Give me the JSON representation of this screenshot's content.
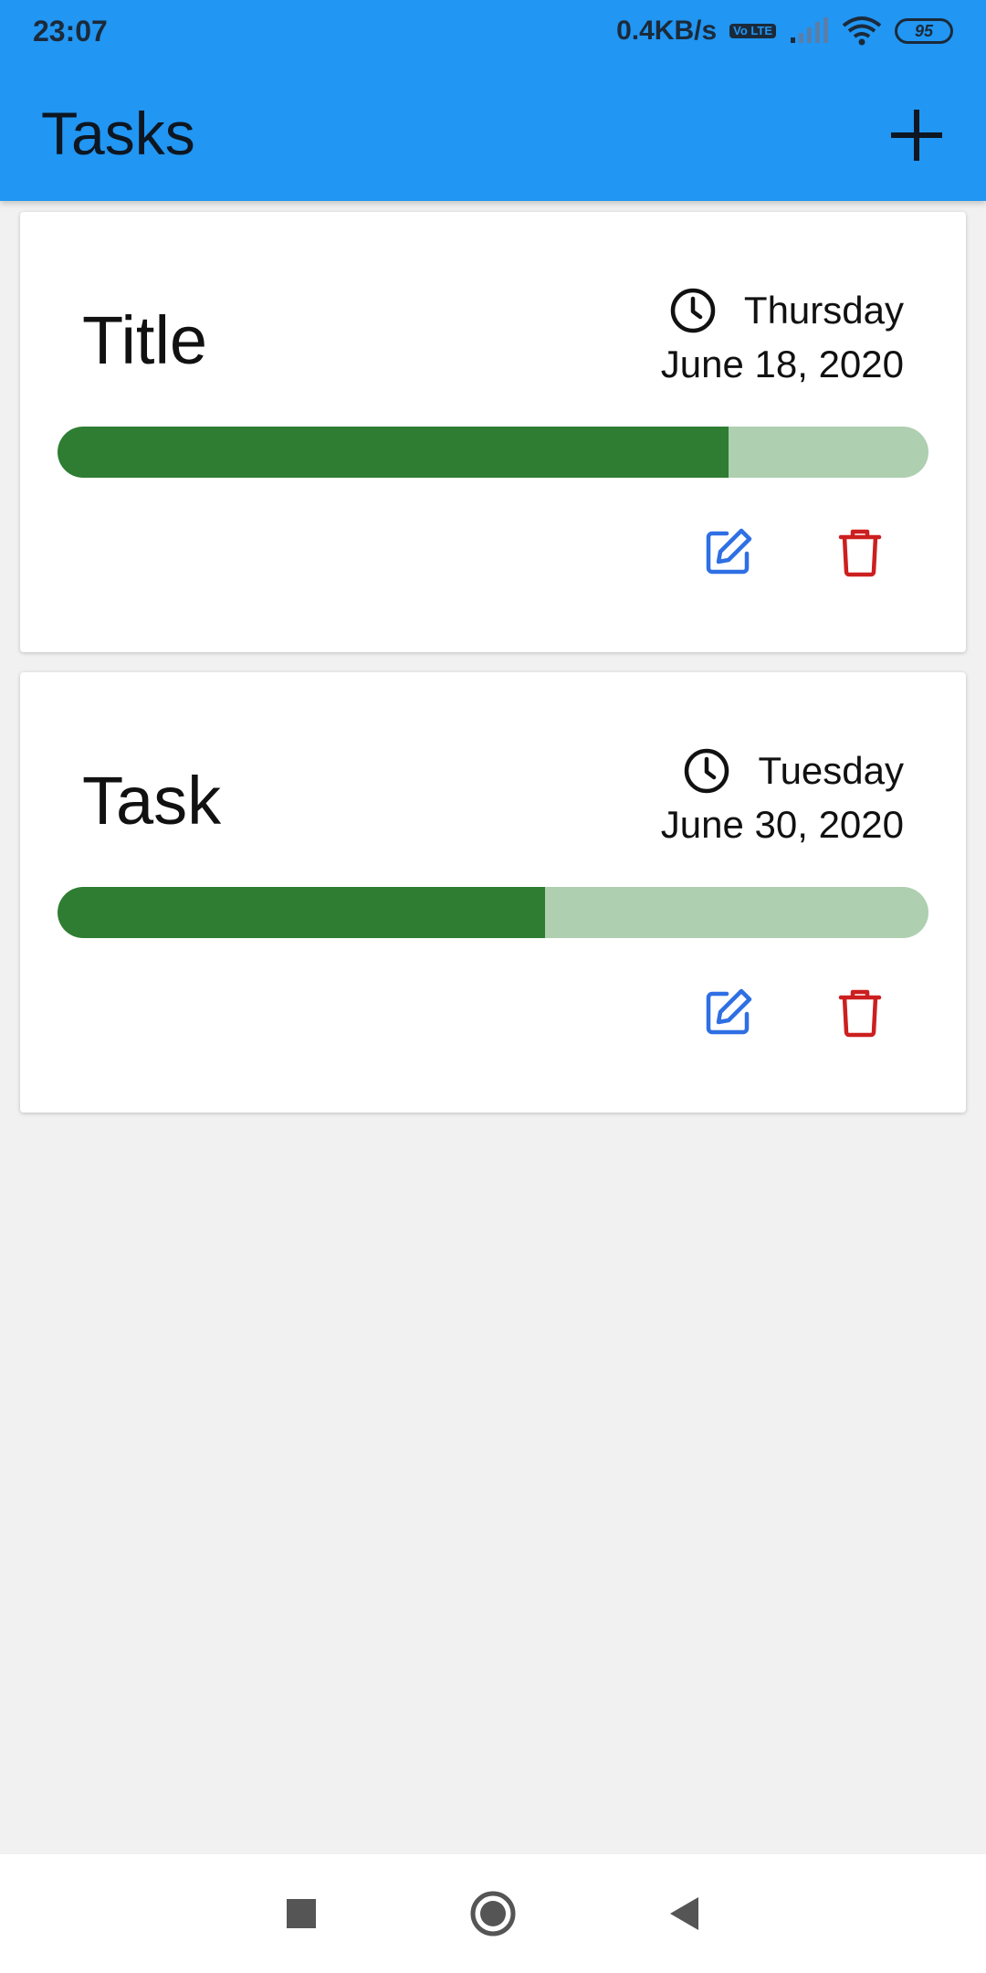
{
  "status_bar": {
    "time": "23:07",
    "net_speed": "0.4KB/s",
    "volte_label": "Vo LTE",
    "battery": "95"
  },
  "app_bar": {
    "title": "Tasks",
    "add_icon": "plus-icon"
  },
  "tasks": [
    {
      "title": "Title",
      "day": "Thursday",
      "date": "June 18, 2020",
      "progress": 0.77,
      "clock_icon": "clock-icon",
      "edit_icon": "edit-icon",
      "delete_icon": "trash-icon"
    },
    {
      "title": "Task",
      "day": "Tuesday",
      "date": "June 30, 2020",
      "progress": 0.56,
      "clock_icon": "clock-icon",
      "edit_icon": "edit-icon",
      "delete_icon": "trash-icon"
    }
  ],
  "colors": {
    "app_bar": "#2196f3",
    "progress_fill": "#2e7d32",
    "progress_track": "#aecfb0",
    "edit_icon": "#2f6fe4",
    "delete_icon": "#cc1f1f"
  },
  "nav_bar": {
    "recents_icon": "square-icon",
    "home_icon": "circle-icon",
    "back_icon": "back-triangle-icon"
  }
}
